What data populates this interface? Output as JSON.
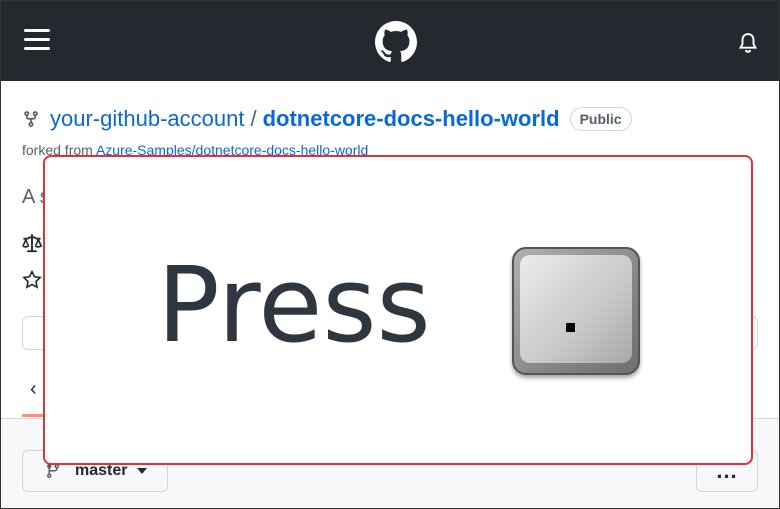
{
  "topbar": {
    "menu_icon": "hamburger-icon",
    "logo_icon": "github-logo-icon",
    "notification_icon": "bell-icon"
  },
  "repo": {
    "owner": "your-github-account",
    "separator": "/",
    "name": "dotnetcore-docs-hello-world",
    "visibility": "Public",
    "forked_prefix": "forked from",
    "forked_link": "Azure-Samples/dotnetcore-docs-hello-world",
    "description_fragment": "A s"
  },
  "branch": {
    "label": "master"
  },
  "more_button": {
    "label": "..."
  },
  "overlay": {
    "prompt": "Press",
    "key": "."
  },
  "colors": {
    "topbar": "#24292f",
    "link": "#0969da",
    "overlay_border": "#d9343a",
    "tab_accent": "#fd8c73"
  }
}
